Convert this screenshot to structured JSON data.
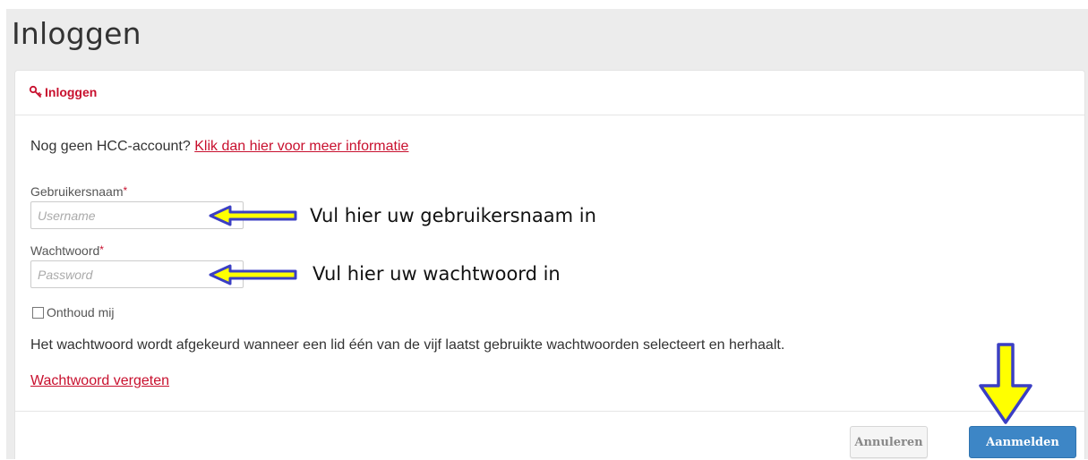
{
  "page": {
    "title": "Inloggen"
  },
  "panel": {
    "heading": "Inloggen",
    "heading_icon": "key-icon",
    "info_text": "Nog geen HCC-account?",
    "info_link": "Klik dan hier voor meer informatie"
  },
  "form": {
    "username_label": "Gebruikersnaam",
    "username_placeholder": "Username",
    "username_value": "",
    "password_label": "Wachtwoord",
    "password_placeholder": "Password",
    "password_value": "",
    "required_marker": "*",
    "remember_label": "Onthoud mij",
    "remember_checked": false,
    "notice": "Het wachtwoord wordt afgekeurd wanneer een lid één van de vijf laatst gebruikte wachtwoorden selecteert en herhaalt.",
    "forgot_link": "Wachtwoord vergeten"
  },
  "footer": {
    "cancel_label": "Annuleren",
    "login_label": "Aanmelden"
  },
  "annotations": {
    "username_hint": "Vul hier uw gebruikersnaam in",
    "password_hint": "Vul hier uw wachtwoord in",
    "arrow_fill": "#ffff00",
    "arrow_stroke": "#3b3fc4"
  },
  "colors": {
    "accent_red": "#c8102e",
    "primary_blue": "#3d86c6",
    "header_gray": "#ececec"
  }
}
